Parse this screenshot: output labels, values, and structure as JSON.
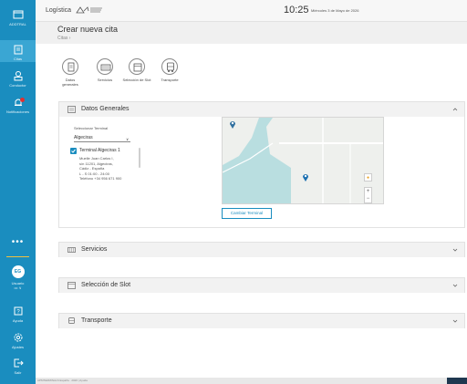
{
  "sidebar": {
    "items": [
      {
        "label": "ADDTRAL",
        "icon": "window-icon"
      },
      {
        "label": "Citas",
        "icon": "calendar-icon"
      },
      {
        "label": "Conductor",
        "icon": "driver-icon"
      },
      {
        "label": "Notificaciones",
        "icon": "bell-icon"
      }
    ],
    "more": "•••",
    "user": {
      "initials": "EG",
      "label": "Usuario",
      "sub": "••• ∨"
    },
    "bottom": [
      {
        "label": "Ayuda",
        "icon": "help-icon"
      },
      {
        "label": "Ajustes",
        "icon": "gear-icon"
      },
      {
        "label": "Salir",
        "icon": "logout-icon"
      }
    ]
  },
  "header": {
    "app_name": "Logística",
    "time": "10:25",
    "date": "Miércoles 3 de Mayo de 2026"
  },
  "page": {
    "title": "Crear nueva cita",
    "breadcrumb": "Citas  ›"
  },
  "stepper": [
    {
      "label": "Datos generales",
      "icon": "document-icon"
    },
    {
      "label": "Servicios",
      "icon": "container-icon"
    },
    {
      "label": "Selección de Slot",
      "icon": "calendar-slot-icon"
    },
    {
      "label": "Transporte",
      "icon": "truck-icon"
    }
  ],
  "sections": {
    "datos": {
      "title": "Datos Generales",
      "terminal_label": "Seleccionar Terminal",
      "terminal_value": "Algeciras",
      "terminal_name": "Terminal Algeciras 1",
      "terminal_lines": [
        "Muelle Juan Carlos I,",
        "s/n 11201, Algeciras,",
        "Cádiz - España",
        "L - S  01:00 - 24:00",
        "Teléfono +34 956 671 900"
      ],
      "map_button": "Cambiar Terminal"
    },
    "servicios": {
      "title": "Servicios"
    },
    "slot": {
      "title": "Selección de Slot"
    },
    "transporte": {
      "title": "Transporte"
    }
  },
  "footer": {
    "text": "APMTERMINALS  España  ·  2026  |  Ayuda"
  },
  "colors": {
    "accent": "#1a8dbf",
    "sidebar_active": "#3aa6d3",
    "notification": "#e03030",
    "map_water": "#b9dee0"
  }
}
